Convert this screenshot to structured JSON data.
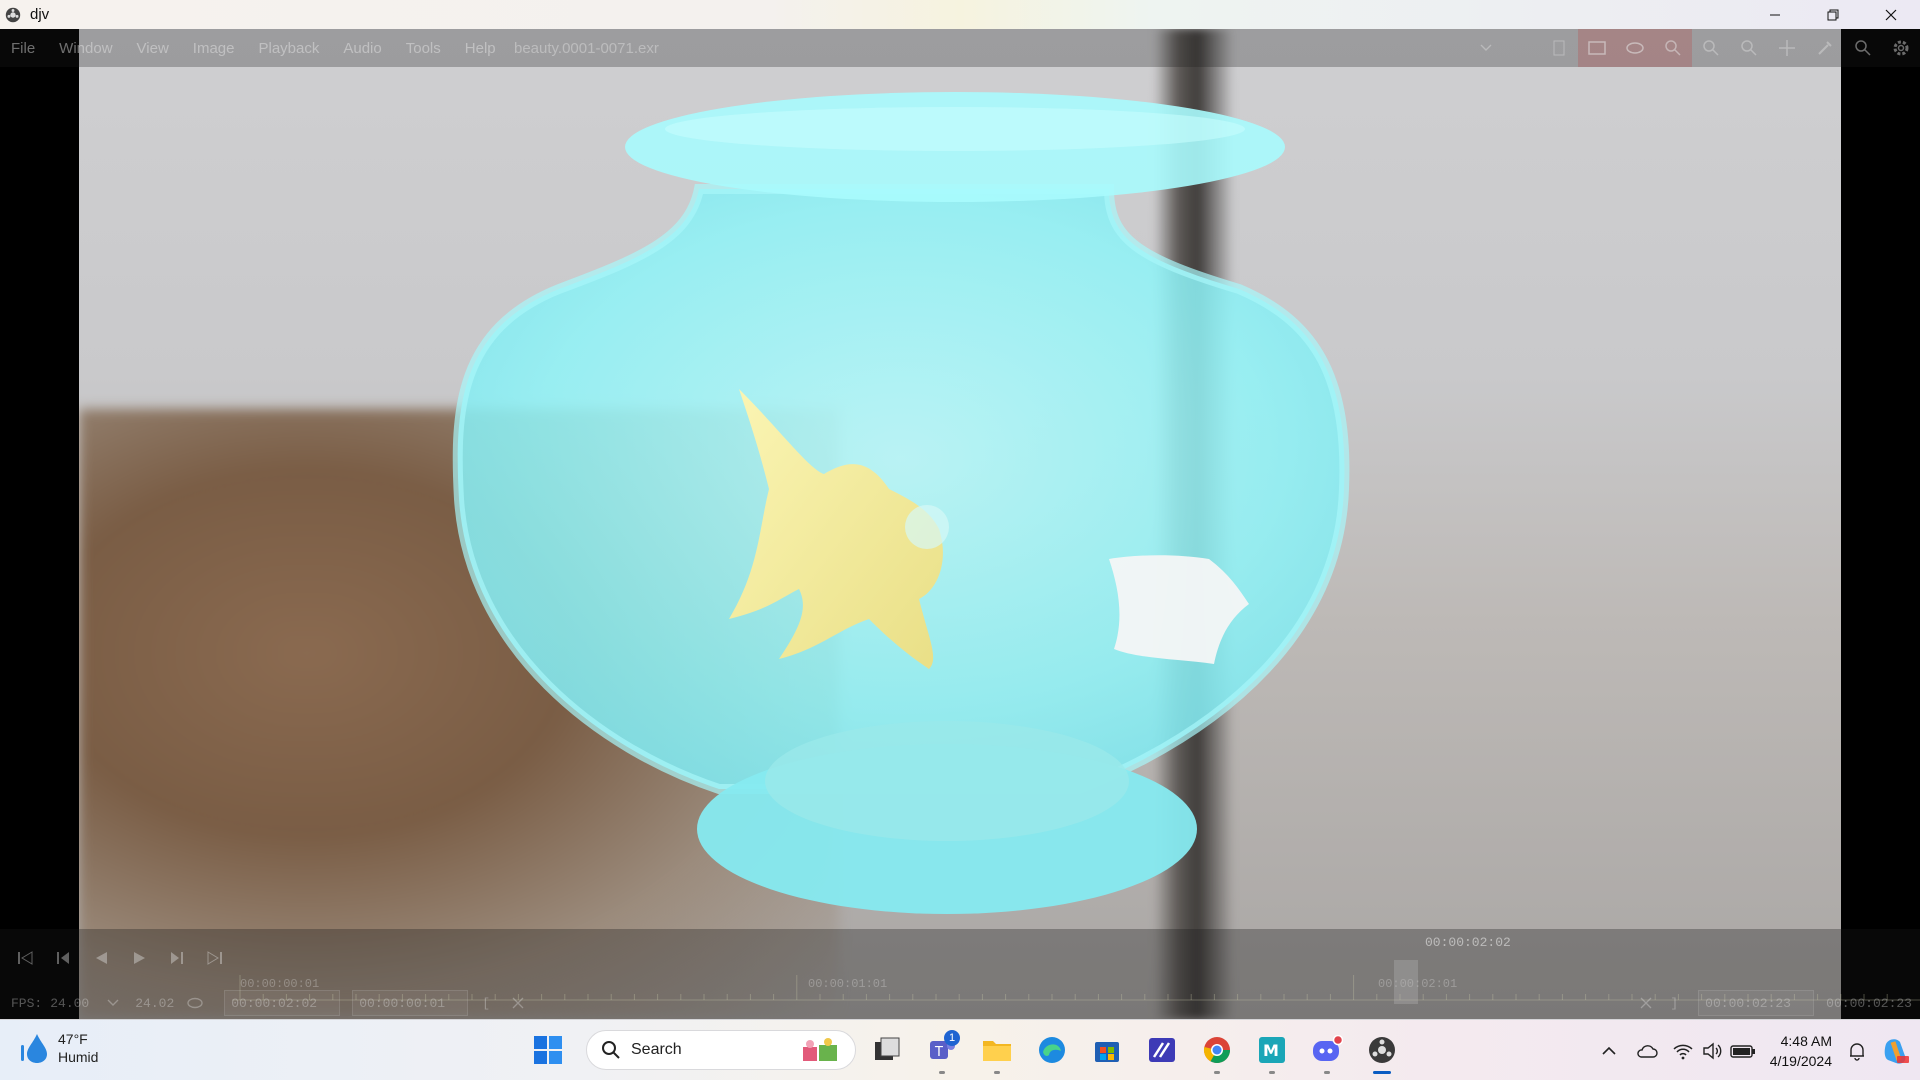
{
  "window": {
    "title": "djv"
  },
  "menu": {
    "items": [
      "File",
      "Window",
      "View",
      "Image",
      "Playback",
      "Audio",
      "Tools",
      "Help"
    ],
    "file_selector": "beauty.0001-0071.exr"
  },
  "timeline": {
    "tick_labels": [
      "00:00:00:01",
      "00:00:01:01",
      "00:00:02:01"
    ],
    "current_time": "00:00:02:02",
    "fps_label": "FPS:",
    "fps_value": "24.00",
    "fps_actual": "24.02",
    "current_field": "00:00:02:02",
    "start_field": "00:00:00:01",
    "in_marker": "[",
    "out_marker": "]",
    "end_field": "00:00:02:23",
    "duration": "00:00:02:23"
  },
  "taskbar": {
    "weather_temp": "47°F",
    "weather_desc": "Humid",
    "search_label": "Search",
    "teams_badge": "1",
    "clock_time": "4:48 AM",
    "clock_date": "4/19/2024"
  },
  "colors": {
    "bowl": "#8ff4f8",
    "fish": "#f4ec9a",
    "taskbar_accent": "#0a5cc2"
  }
}
